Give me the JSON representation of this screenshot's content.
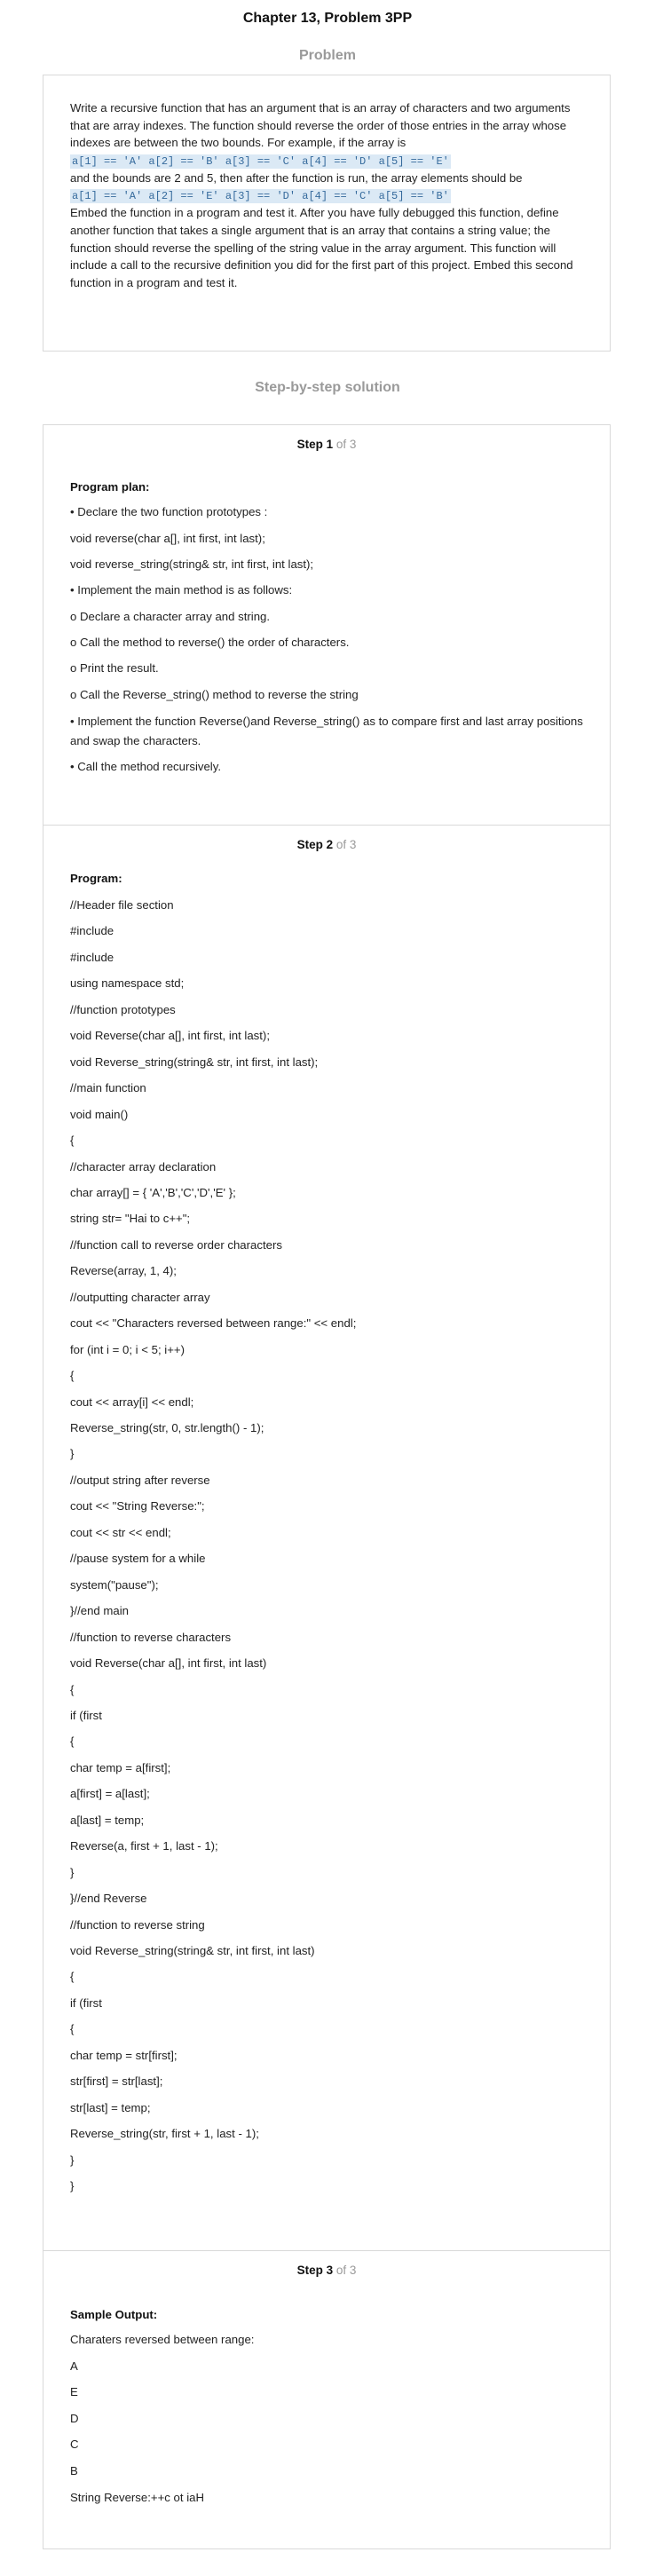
{
  "page_title": "Chapter 13, Problem 3PP",
  "problem_heading": "Problem",
  "problem": {
    "para1": "Write a recursive function that has an argument that is an array of characters and two arguments that are array indexes. The function should reverse the order of those entries in the array whose indexes are between the two bounds. For example, if the array is",
    "code1": "a[1] == 'A' a[2] == 'B' a[3] == 'C' a[4] == 'D' a[5] == 'E'",
    "para2": "and the bounds are 2 and 5, then after the function is run, the array elements should be",
    "code2": "a[1] == 'A' a[2] == 'E' a[3] == 'D' a[4] == 'C' a[5] == 'B'",
    "para3": "Embed the function in a program and test it. After you have fully debugged this function, define another function that takes a single argument that is an array that contains a string value; the function should reverse the spelling of the string value in the array argument. This function will include a call to the recursive definition you did for the first part of this project. Embed this second function in a program and test it."
  },
  "solution_heading": "Step-by-step solution",
  "steps": [
    {
      "label": "Step 1",
      "of": " of 3",
      "title": "Program plan:",
      "lines": [
        "• Declare the two function prototypes :",
        "void reverse(char a[], int first, int last);",
        "void reverse_string(string& str, int first, int last);",
        "• Implement the main method is as follows:",
        "o Declare a character array and string.",
        "o Call the method to reverse() the order of characters.",
        "o Print the result.",
        "o Call the Reverse_string() method to reverse the string",
        "• Implement the function Reverse()and Reverse_string() as to compare first and last array positions and swap the characters.",
        "• Call the method recursively."
      ]
    },
    {
      "label": "Step 2",
      "of": " of 3",
      "title": "Program:",
      "lines": [
        "//Header file section",
        "#include",
        "#include",
        "using namespace std;",
        "//function prototypes",
        "void Reverse(char a[], int first, int last);",
        "void Reverse_string(string& str, int first, int last);",
        "//main function",
        "void main()",
        "{",
        "//character array declaration",
        "char array[] = { 'A','B','C','D','E' };",
        "string str= \"Hai to c++\";",
        "//function call to reverse order characters",
        "Reverse(array, 1, 4);",
        "//outputting character array",
        "cout << \"Characters reversed between range:\" << endl;",
        "for (int i = 0; i < 5; i++)",
        "{",
        "cout << array[i] << endl;",
        "Reverse_string(str, 0, str.length() - 1);",
        "}",
        "//output string after reverse",
        "cout << \"String Reverse:\";",
        "cout << str << endl;",
        "//pause system for a while",
        "system(\"pause\");",
        "}//end main",
        "//function to reverse characters",
        "void Reverse(char a[], int first, int last)",
        "{",
        "if (first",
        "{",
        "char temp = a[first];",
        "a[first] = a[last];",
        "a[last] = temp;",
        "Reverse(a, first + 1, last - 1);",
        "}",
        "}//end Reverse",
        "//function to reverse string",
        "void Reverse_string(string& str, int first, int last)",
        "{",
        "if (first",
        "{",
        "char temp = str[first];",
        "str[first] = str[last];",
        "str[last] = temp;",
        "Reverse_string(str, first + 1, last - 1);",
        "}",
        "}"
      ]
    },
    {
      "label": "Step 3",
      "of": " of 3",
      "title": "Sample Output:",
      "lines": [
        "Charaters reversed between range:",
        "A",
        "E",
        "D",
        "C",
        "B",
        "String Reverse:++c ot iaH"
      ]
    }
  ]
}
